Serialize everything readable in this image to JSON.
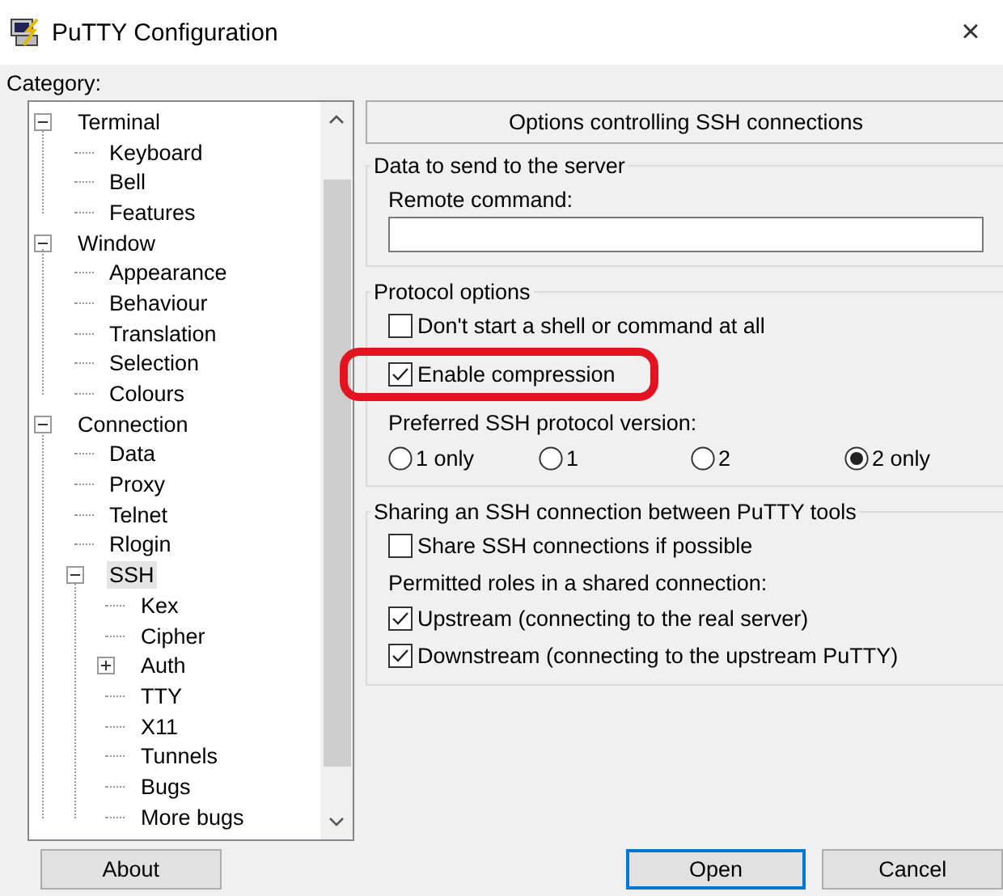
{
  "window": {
    "title": "PuTTY Configuration",
    "close": "×"
  },
  "category_label": "Category:",
  "tree": [
    {
      "label": "Terminal",
      "expanded": true,
      "selected": false,
      "children": [
        {
          "label": "Keyboard",
          "selected": false
        },
        {
          "label": "Bell",
          "selected": false
        },
        {
          "label": "Features",
          "selected": false
        }
      ]
    },
    {
      "label": "Window",
      "expanded": true,
      "selected": false,
      "children": [
        {
          "label": "Appearance",
          "selected": false
        },
        {
          "label": "Behaviour",
          "selected": false
        },
        {
          "label": "Translation",
          "selected": false
        },
        {
          "label": "Selection",
          "selected": false
        },
        {
          "label": "Colours",
          "selected": false
        }
      ]
    },
    {
      "label": "Connection",
      "expanded": true,
      "selected": false,
      "children": [
        {
          "label": "Data",
          "selected": false
        },
        {
          "label": "Proxy",
          "selected": false
        },
        {
          "label": "Telnet",
          "selected": false
        },
        {
          "label": "Rlogin",
          "selected": false
        },
        {
          "label": "SSH",
          "expanded": true,
          "selected": true,
          "children": [
            {
              "label": "Kex",
              "selected": false
            },
            {
              "label": "Cipher",
              "selected": false
            },
            {
              "label": "Auth",
              "expanded": false,
              "selected": false
            },
            {
              "label": "TTY",
              "selected": false
            },
            {
              "label": "X11",
              "selected": false
            },
            {
              "label": "Tunnels",
              "selected": false
            },
            {
              "label": "Bugs",
              "selected": false
            },
            {
              "label": "More bugs",
              "selected": false
            }
          ]
        }
      ]
    }
  ],
  "panel": {
    "header": "Options controlling SSH connections",
    "groups": [
      {
        "title": "Data to send to the server",
        "items": [
          {
            "kind": "label",
            "text": "Remote command:"
          },
          {
            "kind": "field",
            "value": ""
          }
        ]
      },
      {
        "title": "Protocol options",
        "items": [
          {
            "kind": "checkbox",
            "label": "Don't start a shell or command at all",
            "checked": false,
            "highlighted": false
          },
          {
            "kind": "checkbox",
            "label": "Enable compression",
            "checked": true,
            "highlighted": true
          },
          {
            "kind": "label",
            "text": "Preferred SSH protocol version:"
          },
          {
            "kind": "radios",
            "options": [
              {
                "label": "1 only",
                "selected": false
              },
              {
                "label": "1",
                "selected": false
              },
              {
                "label": "2",
                "selected": false
              },
              {
                "label": "2 only",
                "selected": true
              }
            ]
          }
        ]
      },
      {
        "title": "Sharing an SSH connection between PuTTY tools",
        "items": [
          {
            "kind": "checkbox",
            "label": "Share SSH connections if possible",
            "checked": false,
            "highlighted": false
          },
          {
            "kind": "label",
            "text": "Permitted roles in a shared connection:"
          },
          {
            "kind": "checkbox",
            "label": "Upstream (connecting to the real server)",
            "checked": true,
            "highlighted": false
          },
          {
            "kind": "checkbox",
            "label": "Downstream (connecting to the upstream PuTTY)",
            "checked": true,
            "highlighted": false
          }
        ]
      }
    ]
  },
  "buttons": [
    {
      "label": "About",
      "default": false
    },
    {
      "label": "Open",
      "default": true
    },
    {
      "label": "Cancel",
      "default": false
    }
  ]
}
